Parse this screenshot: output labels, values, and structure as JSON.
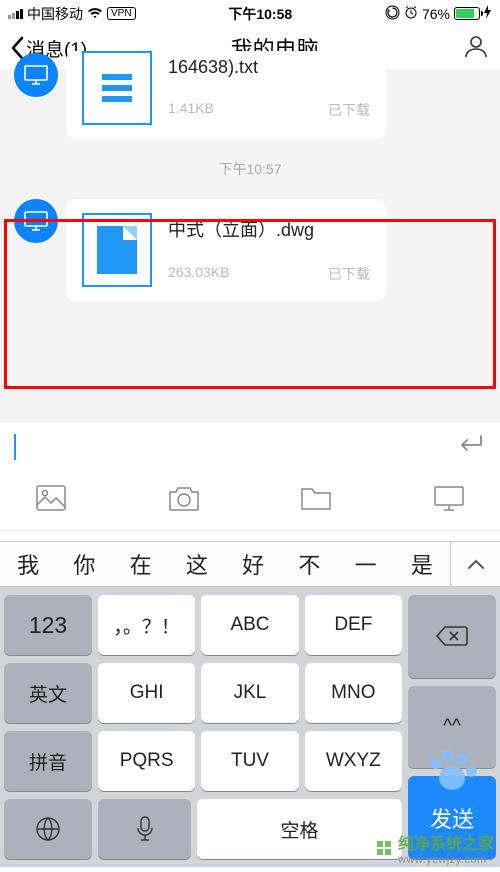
{
  "statusbar": {
    "carrier": "中国移动",
    "vpn": "VPN",
    "time": "下午10:58",
    "battery_pct": "76%"
  },
  "header": {
    "back_label": "消息(1)",
    "title": "我的电脑"
  },
  "chat": {
    "msg1": {
      "name": "164638).txt",
      "size": "1.41KB",
      "status": "已下载"
    },
    "timestamp": "下午10:57",
    "msg2": {
      "name": "中式（立面）.dwg",
      "size": "263.03KB",
      "status": "已下载"
    }
  },
  "candidates": [
    "我",
    "你",
    "在",
    "这",
    "好",
    "不",
    "一",
    "是"
  ],
  "keys": {
    "r1c1": "123",
    "r1c2": "，。？！",
    "r1c3": "ABC",
    "r1c4": "DEF",
    "r2c1": "英文",
    "r2c2": "GHI",
    "r2c3": "JKL",
    "r2c4": "MNO",
    "r2c5": "^^",
    "r3c1": "拼音",
    "r3c2": "PQRS",
    "r3c3": "TUV",
    "r3c4": "WXYZ",
    "space": "空格",
    "send": "发送"
  },
  "watermark": {
    "text": "纯净系统之家",
    "url": "www.ycwjzy.com"
  }
}
